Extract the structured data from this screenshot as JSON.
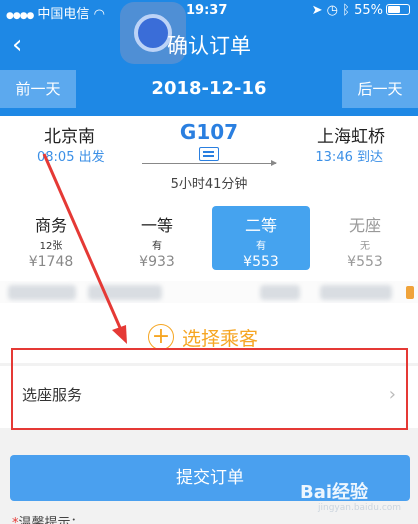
{
  "status_bar": {
    "carrier": "中国电信",
    "time": "19:37",
    "battery": "55%"
  },
  "nav": {
    "title": "确认订单",
    "back_icon": "chevron-left-icon"
  },
  "date_bar": {
    "prev_label": "前一天",
    "date": "2018-12-16",
    "next_label": "后一天"
  },
  "train": {
    "from_station": "北京南",
    "departure": "08:05 出发",
    "to_station": "上海虹桥",
    "arrival": "13:46 到达",
    "number": "G107",
    "duration": "5小时41分钟"
  },
  "seats": [
    {
      "name": "商务",
      "availability": "12张",
      "price": "¥1748"
    },
    {
      "name": "一等",
      "availability": "有",
      "price": "¥933"
    },
    {
      "name": "二等",
      "availability": "有",
      "price": "¥553",
      "selected": true
    },
    {
      "name": "无座",
      "availability": "无",
      "price": "¥553"
    }
  ],
  "passenger": {
    "label": "选择乘客"
  },
  "seat_service": {
    "label": "选座服务"
  },
  "submit": {
    "label": "提交订单"
  },
  "tip": {
    "marker": "*",
    "label": "温馨提示："
  },
  "watermark": {
    "text": "Bai经验",
    "sub": "jingyan.baidu.com"
  },
  "colors": {
    "primary": "#1e88e5",
    "accent": "#f6a623",
    "annotation": "#e53935"
  }
}
